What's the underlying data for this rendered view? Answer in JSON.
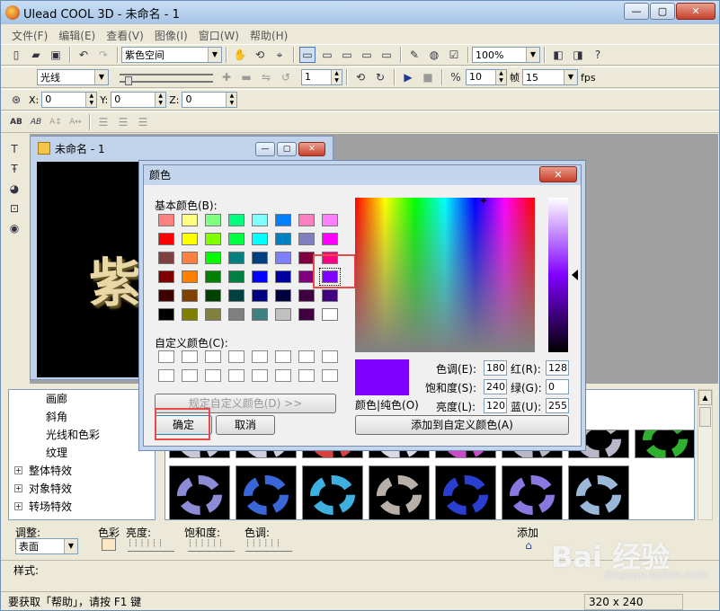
{
  "app": {
    "title": "Ulead COOL 3D - 未命名 - 1",
    "minimize": "—",
    "restore": "▢",
    "close": "✕"
  },
  "menu": [
    "文件(F)",
    "编辑(E)",
    "查看(V)",
    "图像(I)",
    "窗口(W)",
    "帮助(H)"
  ],
  "toolbar1": {
    "style_combo": "紫色空间",
    "zoom_combo": "100%"
  },
  "toolbar2": {
    "light_combo": "光线",
    "frame_value": "1",
    "speed_value": "10",
    "frames_label": "帧",
    "frames_value": "15",
    "fps_label": "fps"
  },
  "toolbar3": {
    "x_label": "X:",
    "x_value": "0",
    "y_label": "Y:",
    "y_value": "0",
    "z_label": "Z:",
    "z_value": "0"
  },
  "document": {
    "title": "未命名 - 1",
    "canvas_text": "紫"
  },
  "tree": {
    "items": [
      "画廊",
      "斜角",
      "光线和色彩",
      "纹理"
    ],
    "roots": [
      "整体特效",
      "对象特效",
      "转场特效"
    ]
  },
  "gallery": {
    "row1_colors": [
      "#c8c8d8",
      "#cfcfe0",
      "#d94040",
      "#d9d9e6",
      "#c84bc8",
      "#b8b8c8",
      "#b8b8c8",
      "#2fb02f"
    ],
    "row2_colors": [
      "#8c8cd6",
      "#3a66d8",
      "#3db0e0",
      "#b8b0a8",
      "#2a3fd0",
      "#8878e0",
      "#9cb8d8"
    ]
  },
  "props": {
    "adjust_label": "调整:",
    "adjust_combo": "表面",
    "color_label": "色彩",
    "brightness_label": "亮度:",
    "saturation_label": "饱和度:",
    "hue_label": "色调:",
    "add_label": "添加"
  },
  "style_label": "样式:",
  "status": {
    "text": "要获取「帮助」，请按 F1 键",
    "size": "320 x 240"
  },
  "watermark": {
    "text": "Bai 经验",
    "sub": "jingyan.baidu.com"
  },
  "dialog": {
    "title": "颜色",
    "close": "✕",
    "basic_label": "基本颜色(B):",
    "custom_label": "自定义颜色(C):",
    "define_button": "规定自定义颜色(D) >>",
    "ok_button": "确定",
    "cancel_button": "取消",
    "add_custom_button": "添加到自定义颜色(A)",
    "solid_label": "颜色|纯色(O)",
    "hue_label": "色调(E):",
    "hue_value": "180",
    "sat_label": "饱和度(S):",
    "sat_value": "240",
    "lum_label": "亮度(L):",
    "lum_value": "120",
    "red_label": "红(R):",
    "red_value": "128",
    "green_label": "绿(G):",
    "green_value": "0",
    "blue_label": "蓝(U):",
    "blue_value": "255",
    "selected_color": "#8000ff",
    "basic_colors": [
      "#ff8080",
      "#ffff80",
      "#80ff80",
      "#00ff80",
      "#80ffff",
      "#0080ff",
      "#ff80c0",
      "#ff80ff",
      "#ff0000",
      "#ffff00",
      "#80ff00",
      "#00ff40",
      "#00ffff",
      "#0080c0",
      "#8080c0",
      "#ff00ff",
      "#804040",
      "#ff8040",
      "#00ff00",
      "#008080",
      "#004080",
      "#8080ff",
      "#800040",
      "#ff0080",
      "#800000",
      "#ff8000",
      "#008000",
      "#008040",
      "#0000ff",
      "#0000a0",
      "#800080",
      "#8000ff",
      "#400000",
      "#804000",
      "#004000",
      "#004040",
      "#000080",
      "#000040",
      "#400040",
      "#400080",
      "#000000",
      "#808000",
      "#808040",
      "#808080",
      "#408080",
      "#c0c0c0",
      "#400040",
      "#ffffff"
    ]
  }
}
